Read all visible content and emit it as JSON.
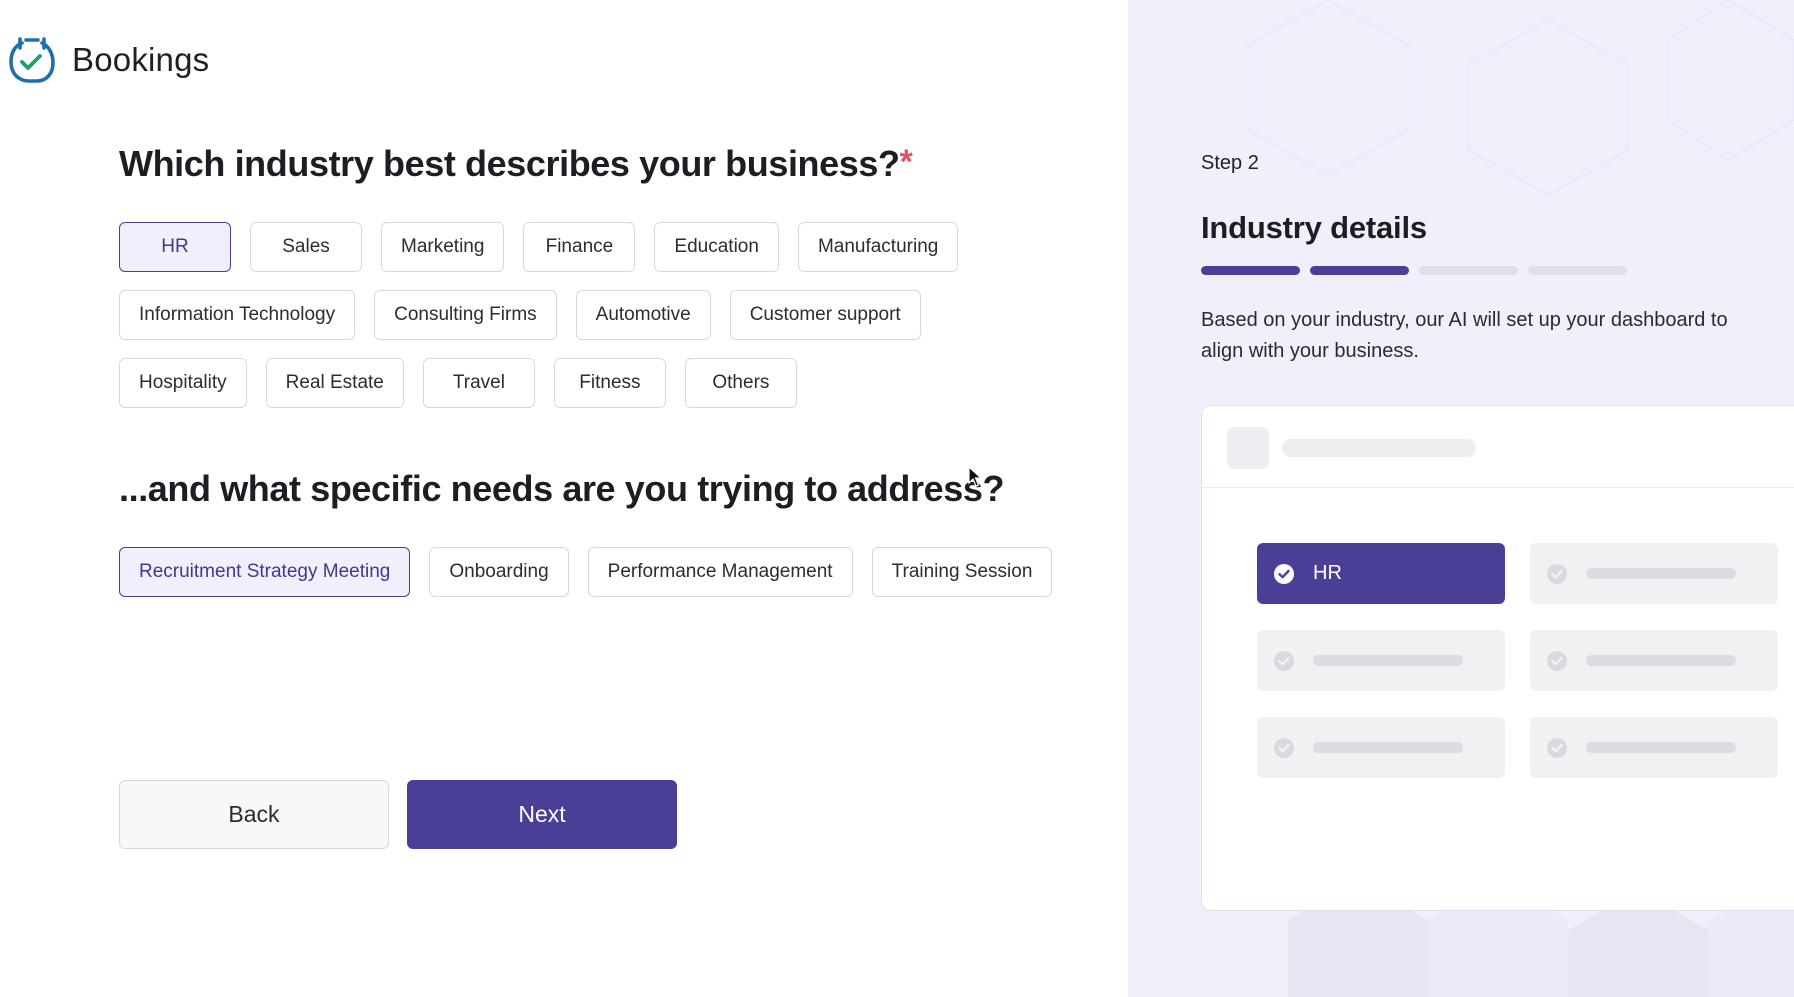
{
  "brand": {
    "name": "Bookings",
    "logo_icon": "calendar-check-icon",
    "color": "#1f6fae"
  },
  "question_industry": {
    "title": "Which industry best describes your business?",
    "required_mark": "*"
  },
  "industries": [
    "HR",
    "Sales",
    "Marketing",
    "Finance",
    "Education",
    "Manufacturing",
    "Information Technology",
    "Consulting Firms",
    "Automotive",
    "Customer support",
    "Hospitality",
    "Real Estate",
    "Travel",
    "Fitness",
    "Others"
  ],
  "selected_industry": "HR",
  "question_needs": {
    "title": "...and what specific needs are you trying to address?"
  },
  "needs": [
    "Recruitment Strategy Meeting",
    "Onboarding",
    "Performance Management",
    "Training Session"
  ],
  "selected_need": "Recruitment Strategy Meeting",
  "buttons": {
    "back": "Back",
    "next": "Next"
  },
  "panel": {
    "step": "Step 2",
    "title": "Industry details",
    "progress": {
      "current": 2,
      "total": 4
    },
    "description": "Based on your industry, our AI will set up your dashboard to align with your business.",
    "preview_selected_label": "HR"
  },
  "colors": {
    "accent": "#4a3f96",
    "required": "#e0525f",
    "panel_bg": "#f1f0fa"
  }
}
